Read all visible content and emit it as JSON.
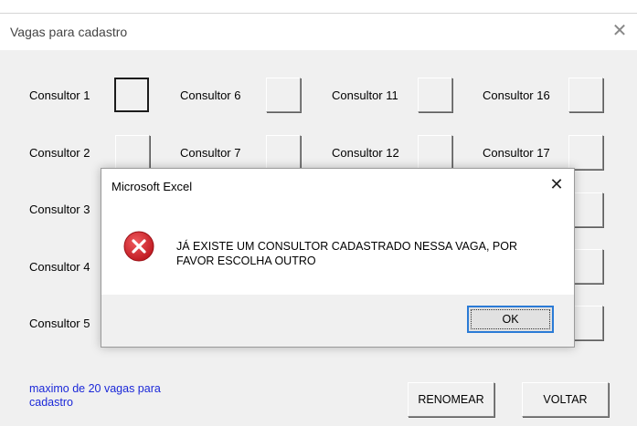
{
  "form": {
    "title": "Vagas para cadastro",
    "note": "maximo de 20 vagas para cadastro",
    "buttons": {
      "rename": "RENOMEAR",
      "back": "VOLTAR"
    },
    "columns": [
      {
        "labels": [
          "Consultor 1",
          "Consultor 2",
          "Consultor 3",
          "Consultor 4",
          "Consultor 5"
        ]
      },
      {
        "labels": [
          "Consultor 6",
          "Consultor 7"
        ]
      },
      {
        "labels": [
          "Consultor 11",
          "Consultor 12"
        ]
      },
      {
        "labels": [
          "Consultor 16",
          "Consultor 17"
        ]
      }
    ]
  },
  "dialog": {
    "title": "Microsoft Excel",
    "message": "JÁ EXISTE UM CONSULTOR CADASTRADO NESSA VAGA, POR FAVOR ESCOLHA OUTRO",
    "ok_label": "OK",
    "icon": "error-icon"
  },
  "colors": {
    "note_text": "#1b28d8",
    "error_red": "#d9232a",
    "accent": "#2b7bd6"
  }
}
